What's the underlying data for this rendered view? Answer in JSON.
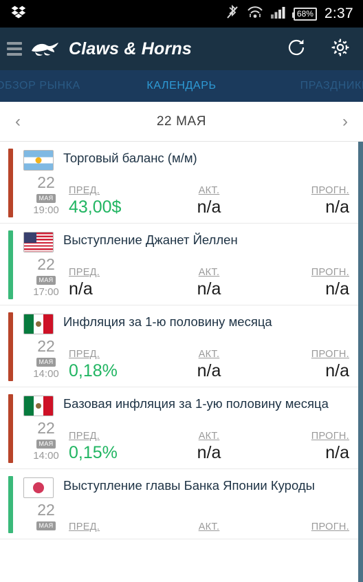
{
  "status_bar": {
    "dropbox_icon": "dropbox-icon",
    "bluetooth_off_icon": "bluetooth-off-icon",
    "wifi_icon": "wifi-icon",
    "signal_icon": "signal-bars-icon",
    "battery_text": "68%",
    "time": "2:37"
  },
  "app_bar": {
    "menu_icon": "hamburger-menu-icon",
    "logo_icon": "bull-bear-logo-icon",
    "title": "Claws & Horns",
    "refresh_icon": "refresh-icon",
    "settings_icon": "gear-icon"
  },
  "tabs": [
    {
      "label": "ОБЗОР РЫНКА",
      "active": false
    },
    {
      "label": "КАЛЕНДАРЬ",
      "active": true
    },
    {
      "label": "ПРАЗДНИКИ",
      "active": false
    }
  ],
  "date_nav": {
    "prev_icon": "chevron-left-icon",
    "date": "22 МАЯ",
    "next_icon": "chevron-right-icon"
  },
  "column_labels": {
    "previous": "ПРЕД.",
    "actual": "АКТ.",
    "forecast": "ПРОГН."
  },
  "colors": {
    "accent_high": "#b8442a",
    "accent_low": "#3ab97a",
    "positive_value": "#21b562",
    "tab_active": "#2e9bd6",
    "tab_bar_bg": "#1b3a5c",
    "app_bar_bg": "#1b3244",
    "scrollbar": "#4b7287"
  },
  "events": [
    {
      "flag": "argentina-flag-icon",
      "flag_class": "f-ar",
      "importance_color": "#b8442a",
      "title": "Торговый баланс (м/м)",
      "day": "22",
      "month": "МАЯ",
      "time": "19:00",
      "previous": "43,00$",
      "previous_positive": true,
      "actual": "n/a",
      "forecast": "n/a"
    },
    {
      "flag": "usa-flag-icon",
      "flag_class": "f-us",
      "importance_color": "#3ab97a",
      "title": "Выступление Джанет Йеллен",
      "day": "22",
      "month": "МАЯ",
      "time": "17:00",
      "previous": "n/a",
      "previous_positive": false,
      "actual": "n/a",
      "forecast": "n/a"
    },
    {
      "flag": "mexico-flag-icon",
      "flag_class": "f-mx",
      "importance_color": "#b8442a",
      "title": "Инфляция за 1-ю половину месяца",
      "day": "22",
      "month": "МАЯ",
      "time": "14:00",
      "previous": "0,18%",
      "previous_positive": true,
      "actual": "n/a",
      "forecast": "n/a"
    },
    {
      "flag": "mexico-flag-icon",
      "flag_class": "f-mx",
      "importance_color": "#b8442a",
      "title": "Базовая инфляция за 1-ую половину месяца",
      "day": "22",
      "month": "МАЯ",
      "time": "14:00",
      "previous": "0,15%",
      "previous_positive": true,
      "actual": "n/a",
      "forecast": "n/a"
    },
    {
      "flag": "japan-flag-icon",
      "flag_class": "f-jp",
      "importance_color": "#3ab97a",
      "title": "Выступление главы Банка Японии Куроды",
      "day": "22",
      "month": "МАЯ",
      "time": "",
      "previous": "",
      "previous_positive": false,
      "actual": "",
      "forecast": ""
    }
  ]
}
